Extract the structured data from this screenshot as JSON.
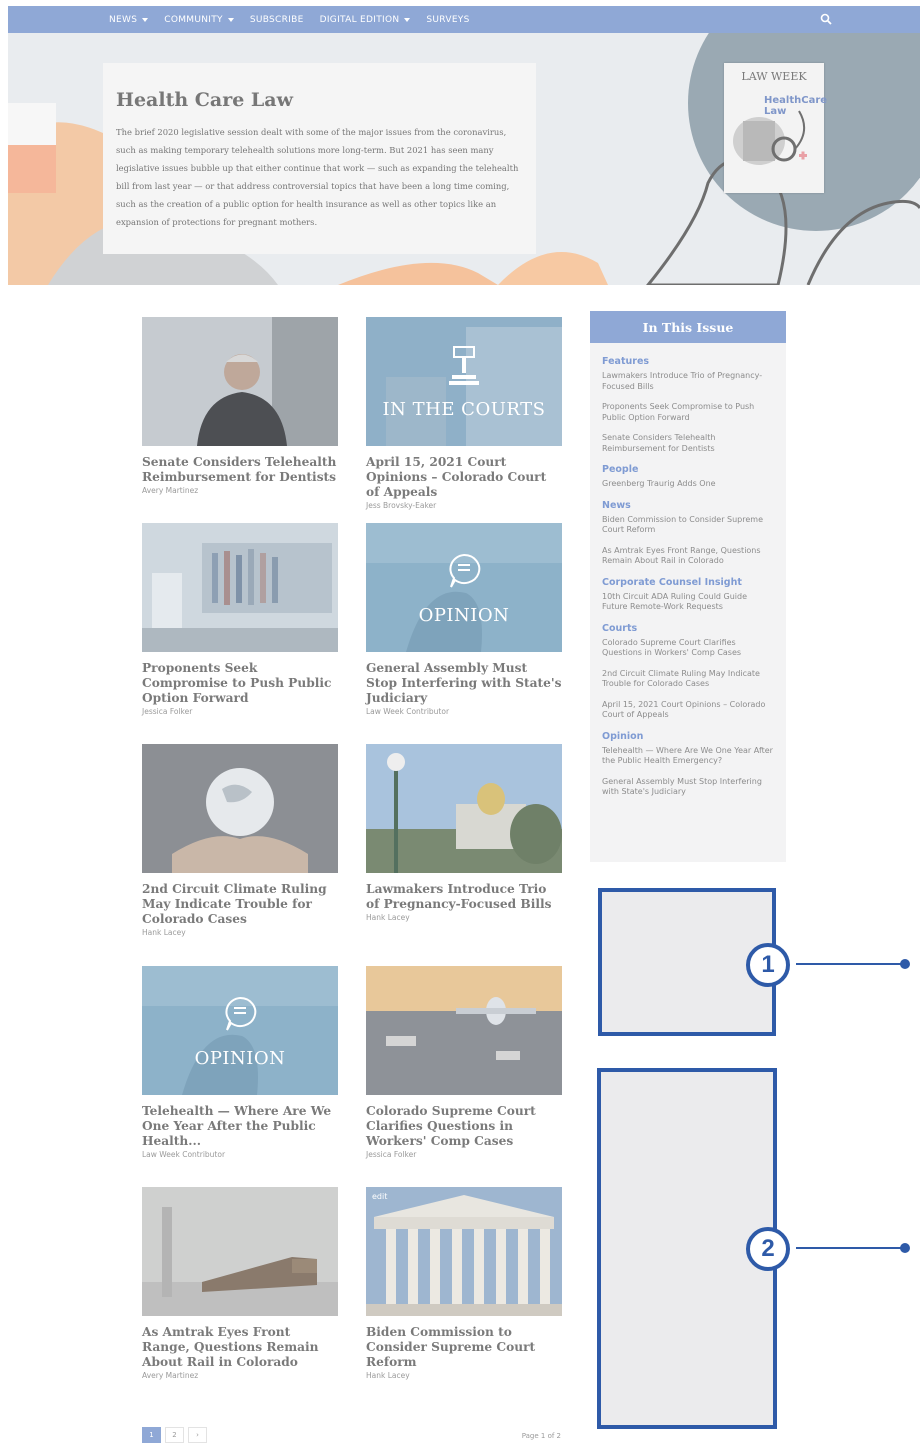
{
  "nav": {
    "items": [
      {
        "label": "NEWS",
        "dropdown": true
      },
      {
        "label": "COMMUNITY",
        "dropdown": true
      },
      {
        "label": "SUBSCRIBE",
        "dropdown": false
      },
      {
        "label": "DIGITAL EDITION",
        "dropdown": true
      },
      {
        "label": "SURVEYS",
        "dropdown": false
      }
    ],
    "search_icon": "search-icon"
  },
  "hero": {
    "title": "Health Care Law",
    "description": "The brief 2020 legislative session dealt with some of the major issues from the coronavirus, such as making temporary telehealth solutions more long-term. But 2021 has seen many legislative issues bubble up that either continue that work — such as expanding the telehealth bill from last year — or that address controversial topics that have been a long time coming, such as the creation of a public option for health insurance as well as other topics like an expansion of protections for pregnant mothers.",
    "cover_brand": "LAW WEEK",
    "cover_title": "HealthCare\nLaw"
  },
  "articles": [
    {
      "title": "Senate Considers Telehealth Reimbursement for Dentists",
      "author": "Avery Martinez",
      "thumb_label": "",
      "edit": ""
    },
    {
      "title": "April 15, 2021 Court Opinions – Colorado Court of Appeals",
      "author": "Jess Brovsky-Eaker",
      "thumb_label": "IN THE COURTS",
      "edit": ""
    },
    {
      "title": "Proponents Seek Compromise to Push Public Option Forward",
      "author": "Jessica Folker",
      "thumb_label": "",
      "edit": ""
    },
    {
      "title": "General Assembly Must Stop Interfering with State's Judiciary",
      "author": "Law Week Contributor",
      "thumb_label": "OPINION",
      "edit": ""
    },
    {
      "title": "2nd Circuit Climate Ruling May Indicate Trouble for Colorado Cases",
      "author": "Hank Lacey",
      "thumb_label": "",
      "edit": ""
    },
    {
      "title": "Lawmakers Introduce Trio of Pregnancy-Focused Bills",
      "author": "Hank Lacey",
      "thumb_label": "",
      "edit": ""
    },
    {
      "title": "Telehealth — Where Are We One Year After the Public Health...",
      "author": "Law Week Contributor",
      "thumb_label": "OPINION",
      "edit": ""
    },
    {
      "title": "Colorado Supreme Court Clarifies Questions in Workers' Comp Cases",
      "author": "Jessica Folker",
      "thumb_label": "",
      "edit": ""
    },
    {
      "title": "As Amtrak Eyes Front Range, Questions Remain About Rail in Colorado",
      "author": "Avery Martinez",
      "thumb_label": "",
      "edit": ""
    },
    {
      "title": "Biden Commission to Consider Supreme Court Reform",
      "author": "Hank Lacey",
      "thumb_label": "",
      "edit": "edit"
    }
  ],
  "sidebar": {
    "title": "In This Issue",
    "sections": [
      {
        "name": "Features",
        "links": [
          "Lawmakers Introduce Trio of Pregnancy-Focused Bills",
          "Proponents Seek Compromise to Push Public Option Forward",
          "Senate Considers Telehealth Reimbursement for Dentists"
        ]
      },
      {
        "name": "People",
        "links": [
          "Greenberg Traurig Adds One"
        ]
      },
      {
        "name": "News",
        "links": [
          "Biden Commission to Consider Supreme Court Reform",
          "As Amtrak Eyes Front Range, Questions Remain About Rail in Colorado"
        ]
      },
      {
        "name": "Corporate Counsel Insight",
        "links": [
          "10th Circuit ADA Ruling Could Guide Future Remote-Work Requests"
        ]
      },
      {
        "name": "Courts",
        "links": [
          "Colorado Supreme Court Clarifies Questions in Workers' Comp Cases",
          "2nd Circuit Climate Ruling May Indicate Trouble for Colorado Cases",
          "April 15, 2021 Court Opinions – Colorado Court of Appeals"
        ]
      },
      {
        "name": "Opinion",
        "links": [
          "Telehealth — Where Are We One Year After the Public Health Emergency?",
          "General Assembly Must Stop Interfering with State's Judiciary"
        ]
      }
    ]
  },
  "annotations": [
    {
      "number": "1"
    },
    {
      "number": "2"
    }
  ],
  "pagination": {
    "pages": [
      "1",
      "2"
    ],
    "current": "1",
    "next": "›",
    "summary": "Page 1 of 2"
  },
  "colors": {
    "brand": "#8fa8d6",
    "annotation": "#2e5aa8",
    "section_heading": "#7f9bd3"
  }
}
